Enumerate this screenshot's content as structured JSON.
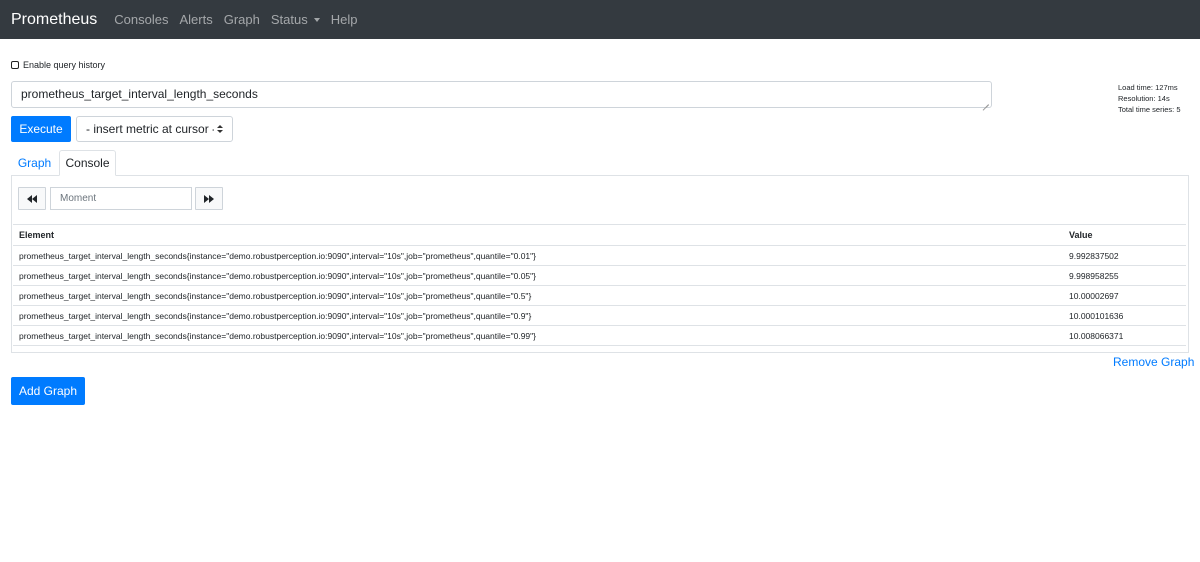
{
  "navbar": {
    "brand": "Prometheus",
    "items": [
      {
        "label": "Consoles"
      },
      {
        "label": "Alerts"
      },
      {
        "label": "Graph"
      },
      {
        "label": "Status"
      },
      {
        "label": "Help"
      }
    ]
  },
  "query_history": {
    "label": "Enable query history",
    "checked": false
  },
  "expression": {
    "value": "prometheus_target_interval_length_seconds"
  },
  "stats": {
    "load_time": "Load time: 127ms",
    "resolution": "Resolution: 14s",
    "total_series": "Total time series: 5"
  },
  "execute_label": "Execute",
  "metric_select": {
    "selected": "- insert metric at cursor -"
  },
  "tabs": [
    {
      "label": "Graph",
      "active": false
    },
    {
      "label": "Console",
      "active": true
    }
  ],
  "moment": {
    "placeholder": "Moment"
  },
  "table": {
    "headers": {
      "element": "Element",
      "value": "Value"
    },
    "rows": [
      {
        "element": "prometheus_target_interval_length_seconds{instance=\"demo.robustperception.io:9090\",interval=\"10s\",job=\"prometheus\",quantile=\"0.01\"}",
        "value": "9.992837502"
      },
      {
        "element": "prometheus_target_interval_length_seconds{instance=\"demo.robustperception.io:9090\",interval=\"10s\",job=\"prometheus\",quantile=\"0.05\"}",
        "value": "9.998958255"
      },
      {
        "element": "prometheus_target_interval_length_seconds{instance=\"demo.robustperception.io:9090\",interval=\"10s\",job=\"prometheus\",quantile=\"0.5\"}",
        "value": "10.00002697"
      },
      {
        "element": "prometheus_target_interval_length_seconds{instance=\"demo.robustperception.io:9090\",interval=\"10s\",job=\"prometheus\",quantile=\"0.9\"}",
        "value": "10.000101636"
      },
      {
        "element": "prometheus_target_interval_length_seconds{instance=\"demo.robustperception.io:9090\",interval=\"10s\",job=\"prometheus\",quantile=\"0.99\"}",
        "value": "10.008066371"
      }
    ]
  },
  "remove_graph_label": "Remove Graph",
  "add_graph_label": "Add Graph",
  "icons": {
    "prev": "backward-icon",
    "next": "forward-icon",
    "status_dropdown": "chevron-down-icon",
    "select": "updown-icon",
    "checkbox": "checkbox-icon",
    "resize": "resize-handle-icon"
  },
  "colors": {
    "navbar": "#343a40",
    "primary": "#007bff",
    "border": "#dee2e6"
  }
}
